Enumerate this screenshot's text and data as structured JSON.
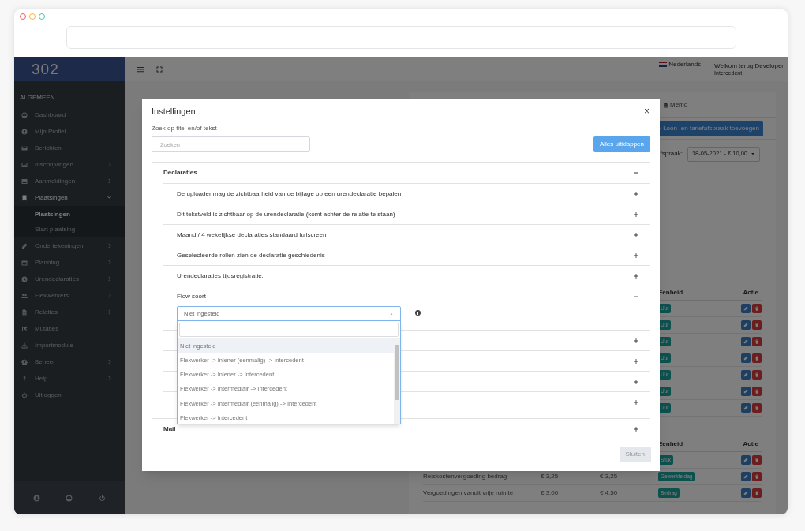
{
  "sidebar": {
    "logo": "302",
    "section_label": "ALGEMEEN",
    "items": [
      {
        "label": "Dashboard",
        "selected": false
      },
      {
        "label": "Mijn Profiel",
        "selected": false
      },
      {
        "label": "Berichten",
        "selected": false
      },
      {
        "label": "Inschrijvingen",
        "selected": false,
        "expanded": false
      },
      {
        "label": "Aanmeldingen",
        "selected": false,
        "expanded": false
      },
      {
        "label": "Plaatsingen",
        "selected": true,
        "expanded": true,
        "children": [
          {
            "label": "Plaatsingen",
            "selected": true
          },
          {
            "label": "Start plaatsing",
            "selected": false
          }
        ]
      },
      {
        "label": "Ondertekeningen",
        "selected": false,
        "expanded": false
      },
      {
        "label": "Planning",
        "selected": false,
        "expanded": false
      },
      {
        "label": "Urendeclaraties",
        "selected": false,
        "expanded": false
      },
      {
        "label": "Flexwerkers",
        "selected": false,
        "expanded": false
      },
      {
        "label": "Relaties",
        "selected": false,
        "expanded": false
      },
      {
        "label": "Mutaties",
        "selected": false
      },
      {
        "label": "Importmodule",
        "selected": false
      },
      {
        "label": "Beheer",
        "selected": false,
        "expanded": false
      },
      {
        "label": "Help",
        "selected": false,
        "expanded": false
      },
      {
        "label": "Uitloggen",
        "selected": false
      }
    ]
  },
  "topbar": {
    "language": "Nederlands",
    "welcome": "Welkom terug Developer",
    "role": "Intercedent"
  },
  "background_panel": {
    "tab": "Memo",
    "add_button": "Loon- en tariefafspraak toevoegen",
    "filter_label": "fspraak:",
    "filter_value": "18-05-2021 - € 10,00",
    "tables": [
      {
        "columns": [
          "Eenheid",
          "Actie"
        ],
        "rows": [
          {
            "unit": "Uur"
          },
          {
            "unit": "Uur"
          },
          {
            "unit": "Uur"
          },
          {
            "unit": "Uur"
          },
          {
            "unit": "Uur"
          },
          {
            "unit": "Uur"
          },
          {
            "unit": "Uur"
          }
        ]
      },
      {
        "columns": [
          "Eenheid",
          "Actie"
        ],
        "rows": [
          {
            "unit": "Stuk"
          },
          {
            "name": "Reiskostenvergoeding bedrag",
            "column_2": "€ 3,25",
            "column_3": "€ 3,25",
            "unit": "Gewerkte dag"
          },
          {
            "name": "Vergoedingen vanuit vrije ruimte",
            "column_2": "€ 3,00",
            "column_3": "€ 4,50",
            "unit": "Bedrag"
          }
        ]
      }
    ]
  },
  "modal": {
    "title": "Instellingen",
    "close": "×",
    "search": {
      "label": "Zoek op titel en/of tekst",
      "placeholder": "Zoeken"
    },
    "expand_all_button": "Alles uitklappen",
    "sections": [
      {
        "title": "Declaraties",
        "expanded": true,
        "items": [
          {
            "title": "De uploader mag de zichtbaarheid van de bijlage op een urendeclaratie bepalen",
            "expanded": false
          },
          {
            "title": "Dit tekstveld is zichtbaar op de urendeclaratie (komt achter de relatie te staan)",
            "expanded": false
          },
          {
            "title": "Maand / 4 wekelijkse declaraties standaard fullscreen",
            "expanded": false
          },
          {
            "title": "Geselecteerde rollen zien de declaratie geschiedenis",
            "expanded": false
          },
          {
            "title": "Urendeclaraties tijdsregistratie.",
            "expanded": false
          },
          {
            "title": "Flow soort",
            "expanded": true,
            "select": {
              "value": "Niet ingesteld",
              "open": true,
              "options": [
                {
                  "label": "Niet ingesteld",
                  "selected": true
                },
                {
                  "label": "Flexwerker -> Inlener (eenmalig) -> Intercedent",
                  "selected": false
                },
                {
                  "label": "Flexwerker -> Inlener -> Intercedent",
                  "selected": false
                },
                {
                  "label": "Flexwerker -> Intermediair -> Intercedent",
                  "selected": false
                },
                {
                  "label": "Flexwerker -> Intermediair (eenmalig) -> Intercedent",
                  "selected": false
                },
                {
                  "label": "Flexwerker -> Intercedent",
                  "selected": false
                }
              ]
            }
          },
          {
            "expanded": false
          },
          {
            "expanded": false
          },
          {
            "expanded": false
          },
          {
            "expanded": false
          }
        ]
      },
      {
        "title": "Mail",
        "expanded": false
      }
    ],
    "close_button": "Sluiten"
  }
}
